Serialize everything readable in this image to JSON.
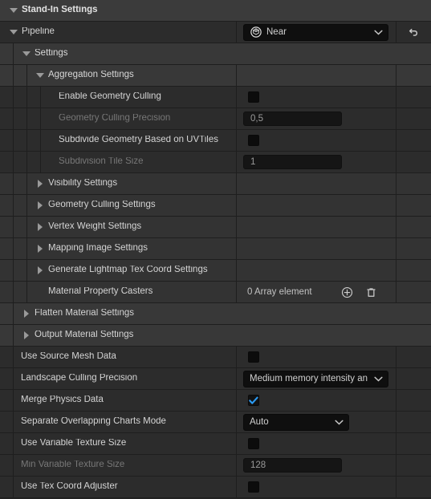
{
  "panel": {
    "title": "Stand-In Settings",
    "colors": {
      "accent": "#2b9bf4",
      "panel_bg": "#242424",
      "row_bg": "#2c2c2c",
      "category_bg": "#383838",
      "title_bg": "#3b3b3b",
      "text": "#d4d4d4",
      "text_disabled": "#777777"
    }
  },
  "rows": {
    "title": {
      "label": "Stand-In Settings",
      "icon": "caret-down-icon"
    },
    "pipeline": {
      "label": "Pipeline",
      "icon": "caret-down-icon",
      "value": "Near",
      "value_icon": "asset-sphere-icon",
      "dropdown_icon": "chevron-down-icon",
      "reset_icon": "reset-arrow-icon"
    },
    "settings": {
      "label": "Settings",
      "icon": "caret-down-icon"
    },
    "aggregation_settings": {
      "label": "Aggregation Settings",
      "icon": "caret-down-icon"
    },
    "enable_geometry_culling": {
      "label": "Enable Geometry Culling",
      "checked": false,
      "icon": "checkbox-icon"
    },
    "geometry_culling_precision": {
      "label": "Geometry Culling Precision",
      "value": "0,5",
      "disabled": true
    },
    "subdivide_geometry_based_on_uvtiles": {
      "label": "Subdivide Geometry Based on UVTiles",
      "checked": false,
      "icon": "checkbox-icon"
    },
    "subdivision_tile_size": {
      "label": "Subdivision Tile Size",
      "value": "1",
      "disabled": true
    },
    "visibility_settings": {
      "label": "Visibility Settings",
      "icon": "caret-right-icon"
    },
    "geometry_culling_settings": {
      "label": "Geometry Culling Settings",
      "icon": "caret-right-icon"
    },
    "vertex_weight_settings": {
      "label": "Vertex Weight Settings",
      "icon": "caret-right-icon"
    },
    "mapping_image_settings": {
      "label": "Mapping Image Settings",
      "icon": "caret-right-icon"
    },
    "generate_lightmap_tex_coord_settings": {
      "label": "Generate Lightmap Tex Coord Settings",
      "icon": "caret-right-icon"
    },
    "material_property_casters": {
      "label": "Material Property Casters",
      "count_text": "0 Array element",
      "add_icon": "plus-circle-icon",
      "delete_icon": "trash-icon"
    },
    "flatten_material_settings": {
      "label": "Flatten Material Settings",
      "icon": "caret-right-icon"
    },
    "output_material_settings": {
      "label": "Output Material Settings",
      "icon": "caret-right-icon"
    },
    "use_source_mesh_data": {
      "label": "Use Source Mesh Data",
      "checked": false,
      "icon": "checkbox-icon"
    },
    "landscape_culling_precision": {
      "label": "Landscape Culling Precision",
      "value": "Medium memory intensity an",
      "dropdown_icon": "chevron-down-icon"
    },
    "merge_physics_data": {
      "label": "Merge Physics Data",
      "checked": true,
      "icon": "checkbox-checked-icon"
    },
    "separate_overlapping_charts_mode": {
      "label": "Separate Overlapping Charts Mode",
      "value": "Auto",
      "dropdown_icon": "chevron-down-icon"
    },
    "use_variable_texture_size": {
      "label": "Use Variable Texture Size",
      "checked": false,
      "icon": "checkbox-icon"
    },
    "min_variable_texture_size": {
      "label": "Min Variable Texture Size",
      "value": "128",
      "disabled": true
    },
    "use_tex_coord_adjuster": {
      "label": "Use Tex Coord Adjuster",
      "checked": false,
      "icon": "checkbox-icon"
    }
  }
}
